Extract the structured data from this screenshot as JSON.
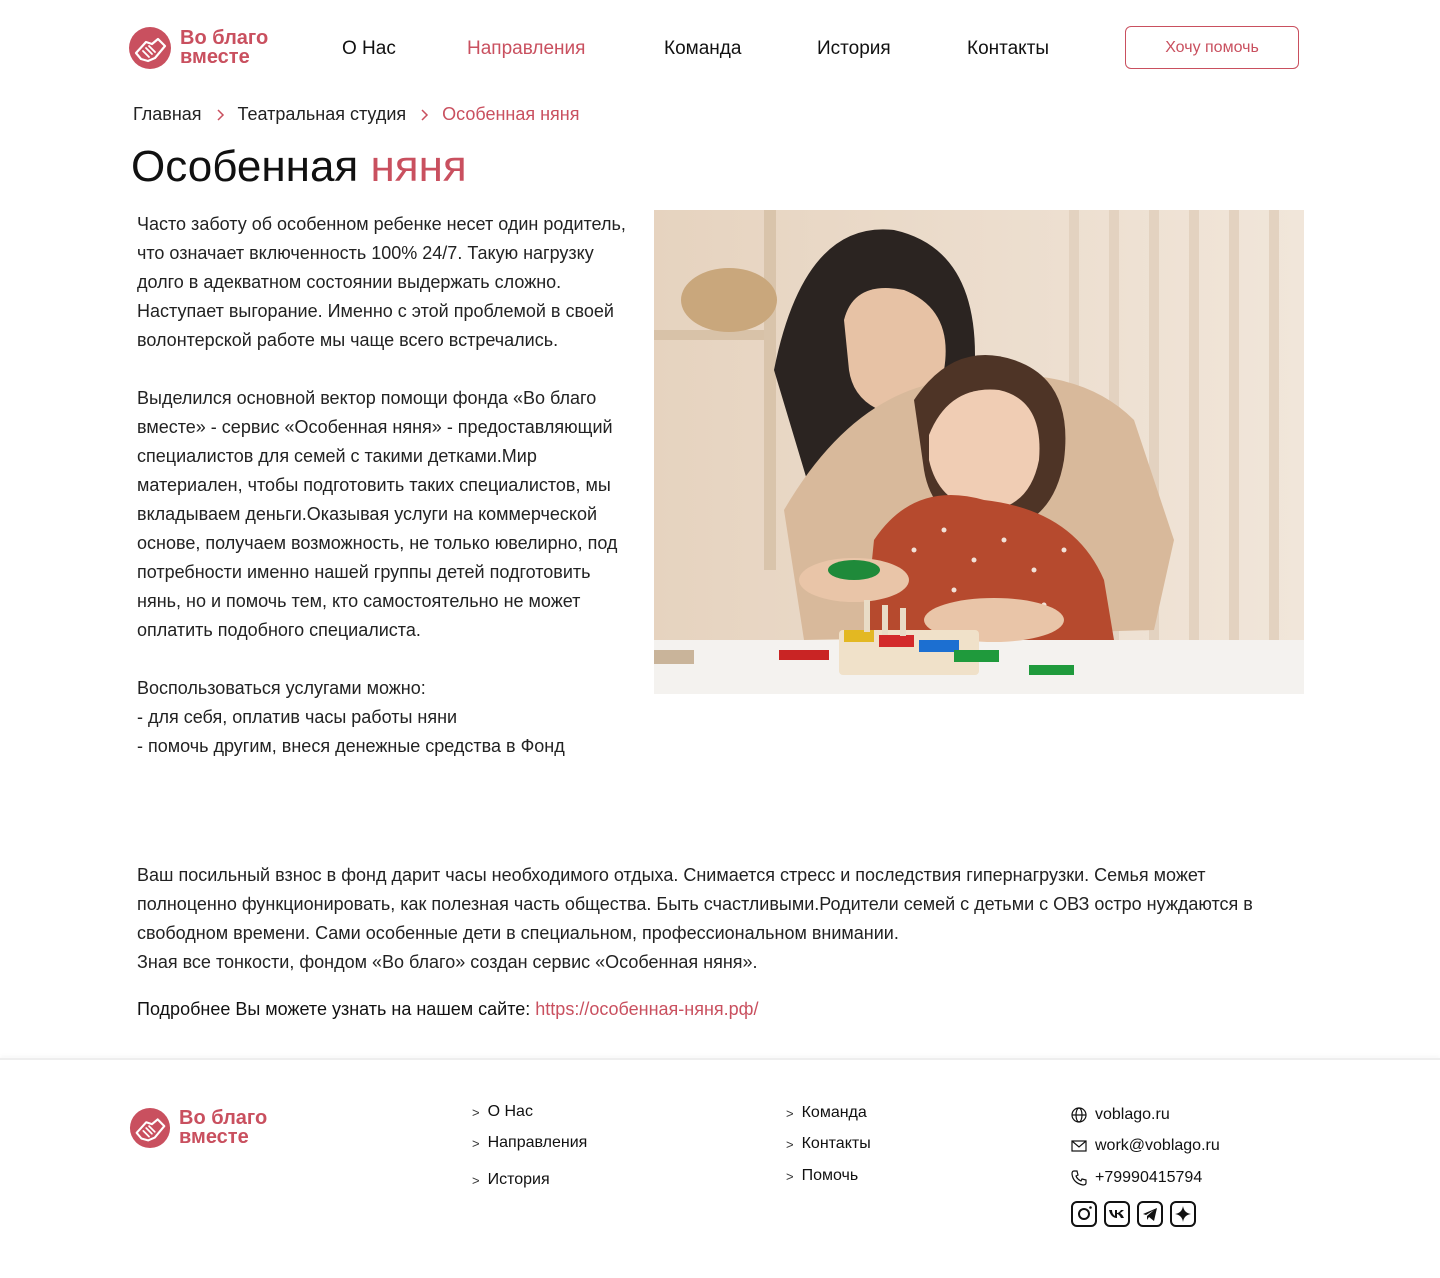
{
  "header": {
    "logo_line1": "Во благо",
    "logo_line2": "вместе",
    "nav": [
      {
        "label": "О Нас"
      },
      {
        "label": "Направления"
      },
      {
        "label": "Команда"
      },
      {
        "label": "История"
      },
      {
        "label": "Контакты"
      }
    ],
    "cta": "Хочу помочь"
  },
  "breadcrumb": [
    "Главная",
    "Театральная студия",
    "Особенная няня"
  ],
  "title": {
    "part1": "Особенная",
    "part2": "няня"
  },
  "paragraphs": [
    "Часто заботу об особенном ребенке несет один родитель, что означает включенность 100% 24/7. Такую нагрузку долго в адекватном состоянии выдержать сложно. Наступает выгорание. Именно с этой проблемой в своей волонтерской работе мы чаще всего встречались.",
    "Выделился основной вектор помощи фонда «Во благо вместе» - сервис «Особенная няня» - предоставляющий специалистов для семей с такими детками.Мир материален, чтобы подготовить таких специалистов, мы вкладываем деньги.Оказывая услуги на коммерческой основе, получаем возможность, не только ювелирно, под потребности именно нашей группы детей подготовить нянь, но и помочь тем, кто самостоятельно не может оплатить подобного специалиста."
  ],
  "services": {
    "intro": "Воспользоваться услугами  можно:",
    "items": [
      "- для себя, оплатив часы работы няни",
      "- помочь другим, внеся денежные средства в Фонд"
    ]
  },
  "wide_text": {
    "p1": "Ваш посильный взнос в фонд дарит часы необходимого отдыха. Снимается стресс и последствия гипернагрузки. Семья может полноценно функционировать, как полезная часть общества. Быть счастливыми.Родители семей с детьми с ОВЗ остро нуждаются в свободном времени. Сами особенные дети в специальном, профессиональном внимании.",
    "p2": "Зная все тонкости, фондом «Во благо» создан сервис «Особенная няня»."
  },
  "more": {
    "label": "Подробнее Вы можете узнать на нашем сайте:",
    "link": "https://особенная-няня.рф/"
  },
  "footer": {
    "logo_line1": "Во благо",
    "logo_line2": "вместе",
    "col1": [
      "О Нас",
      "Направления",
      "История"
    ],
    "col2": [
      "Команда",
      "Контакты",
      "Помочь"
    ],
    "site": "voblago.ru",
    "email": "work@voblago.ru",
    "phone": "+79990415794",
    "socials": [
      "instagram-icon",
      "vk-icon",
      "telegram-icon",
      "star-icon"
    ]
  },
  "colors": {
    "accent": "#c9505f"
  }
}
